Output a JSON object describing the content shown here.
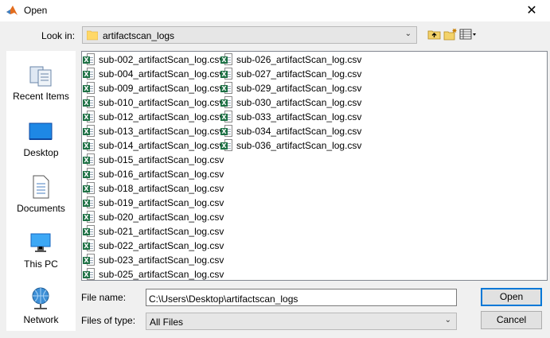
{
  "window": {
    "title": "Open",
    "close_glyph": "✕"
  },
  "look_in": {
    "label": "Look in:",
    "value": "artifactscan_logs"
  },
  "toolbar": [
    "up-folder-icon",
    "new-folder-icon",
    "view-menu-icon"
  ],
  "places": [
    {
      "label": "Recent Items",
      "icon": "recent-items-icon"
    },
    {
      "label": "Desktop",
      "icon": "desktop-icon"
    },
    {
      "label": "Documents",
      "icon": "documents-icon"
    },
    {
      "label": "This PC",
      "icon": "this-pc-icon"
    },
    {
      "label": "Network",
      "icon": "network-icon"
    }
  ],
  "files_col1": [
    "sub-002_artifactScan_log.csv",
    "sub-004_artifactScan_log.csv",
    "sub-009_artifactScan_log.csv",
    "sub-010_artifactScan_log.csv",
    "sub-012_artifactScan_log.csv",
    "sub-013_artifactScan_log.csv",
    "sub-014_artifactScan_log.csv",
    "sub-015_artifactScan_log.csv",
    "sub-016_artifactScan_log.csv",
    "sub-018_artifactScan_log.csv",
    "sub-019_artifactScan_log.csv",
    "sub-020_artifactScan_log.csv",
    "sub-021_artifactScan_log.csv",
    "sub-022_artifactScan_log.csv",
    "sub-023_artifactScan_log.csv",
    "sub-025_artifactScan_log.csv"
  ],
  "files_col2": [
    "sub-026_artifactScan_log.csv",
    "sub-027_artifactScan_log.csv",
    "sub-029_artifactScan_log.csv",
    "sub-030_artifactScan_log.csv",
    "sub-033_artifactScan_log.csv",
    "sub-034_artifactScan_log.csv",
    "sub-036_artifactScan_log.csv"
  ],
  "file_name": {
    "label": "File name:",
    "value": "C:\\Users\\Desktop\\artifactscan_logs"
  },
  "file_type": {
    "label": "Files of type:",
    "value": "All Files"
  },
  "buttons": {
    "open": "Open",
    "cancel": "Cancel"
  },
  "colors": {
    "accent": "#0078d7",
    "excel_green": "#1e7145",
    "folder": "#ffd867"
  }
}
